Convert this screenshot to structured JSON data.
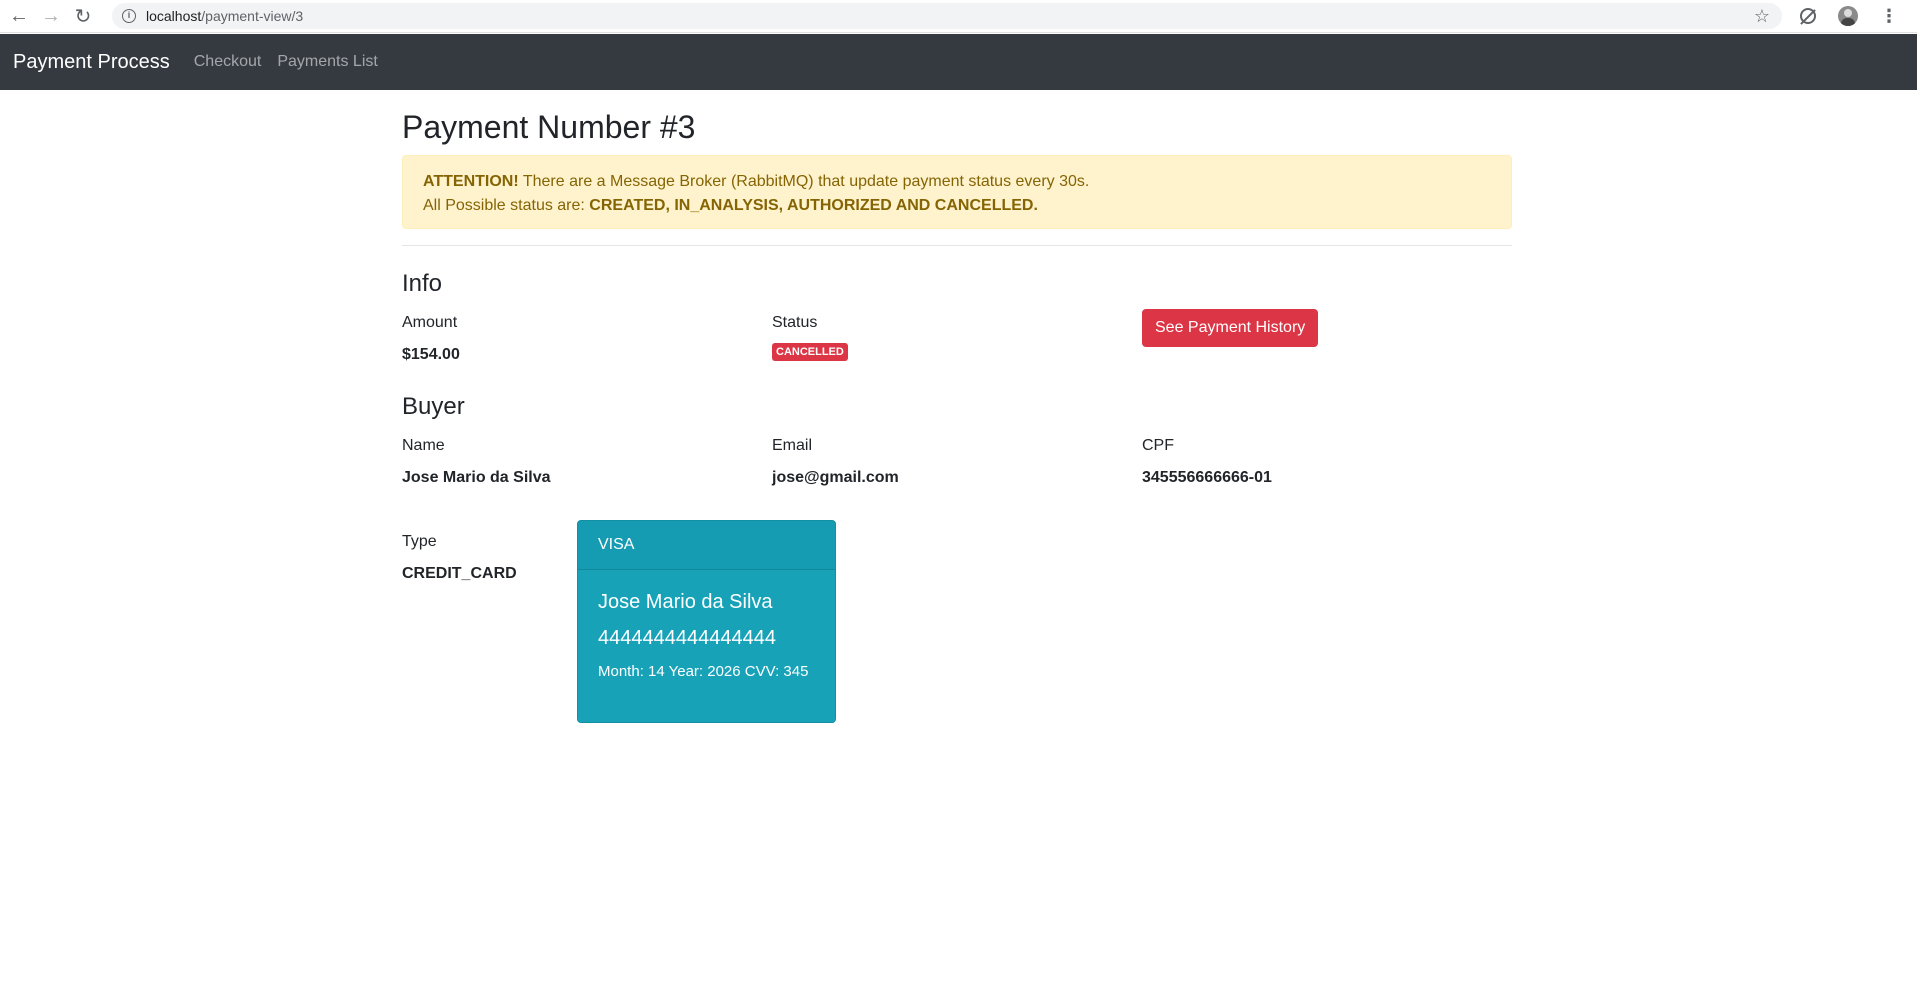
{
  "browser": {
    "url_host": "localhost",
    "url_path": "/payment-view/3"
  },
  "navbar": {
    "brand": "Payment Process",
    "links": [
      "Checkout",
      "Payments List"
    ]
  },
  "page": {
    "title": "Payment Number #3"
  },
  "alert": {
    "strong": "ATTENTION!",
    "line1": " There are a Message Broker (RabbitMQ) that update payment status every 30s.",
    "line2_prefix": "All Possible status are: ",
    "line2_strong": "CREATED, IN_ANALYSIS, AUTHORIZED AND CANCELLED."
  },
  "info": {
    "title": "Info",
    "amount_label": "Amount",
    "amount_value": "$154.00",
    "status_label": "Status",
    "status_value": "CANCELLED",
    "history_button": "See Payment History"
  },
  "buyer": {
    "title": "Buyer",
    "name_label": "Name",
    "name_value": "Jose Mario da Silva",
    "email_label": "Email",
    "email_value": "jose@gmail.com",
    "cpf_label": "CPF",
    "cpf_value": "345556666666-01"
  },
  "payment": {
    "type_label": "Type",
    "type_value": "CREDIT_CARD",
    "card": {
      "brand": "VISA",
      "holder": "Jose Mario da Silva",
      "number": "4444444444444444",
      "details": "Month: 14 Year: 2026 CVV: 345"
    }
  },
  "colors": {
    "navbar": "#343a40",
    "danger": "#dc3545",
    "info_card": "#17a2b8",
    "alert_bg": "#fff3cd",
    "alert_text": "#856404"
  }
}
